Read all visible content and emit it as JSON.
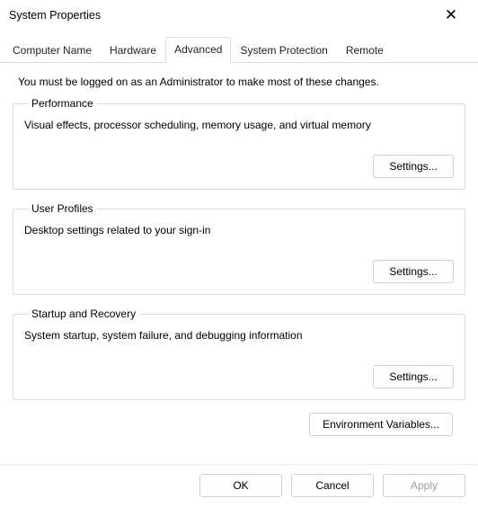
{
  "window": {
    "title": "System Properties"
  },
  "tabs": {
    "computer_name": "Computer Name",
    "hardware": "Hardware",
    "advanced": "Advanced",
    "system_protection": "System Protection",
    "remote": "Remote",
    "active": "advanced"
  },
  "intro": "You must be logged on as an Administrator to make most of these changes.",
  "groups": {
    "performance": {
      "legend": "Performance",
      "desc": "Visual effects, processor scheduling, memory usage, and virtual memory",
      "button": "Settings..."
    },
    "user_profiles": {
      "legend": "User Profiles",
      "desc": "Desktop settings related to your sign-in",
      "button": "Settings..."
    },
    "startup_recovery": {
      "legend": "Startup and Recovery",
      "desc": "System startup, system failure, and debugging information",
      "button": "Settings..."
    }
  },
  "env_button": "Environment Variables...",
  "footer": {
    "ok": "OK",
    "cancel": "Cancel",
    "apply": "Apply"
  }
}
